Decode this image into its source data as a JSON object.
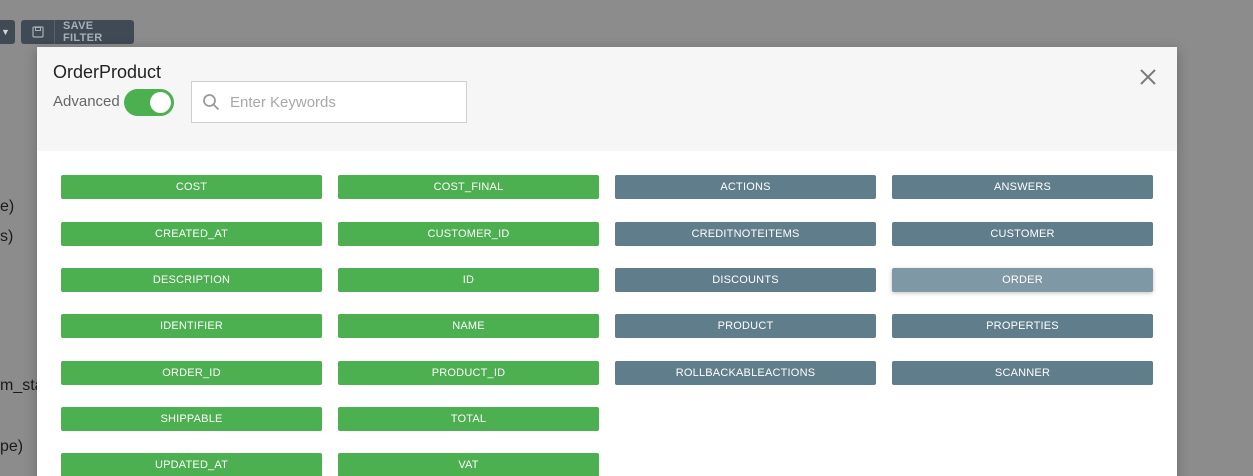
{
  "background": {
    "save_filter_label": "SAVE FILTER",
    "fragments": [
      "e)",
      "s)",
      "m_sta",
      "pe)"
    ]
  },
  "modal": {
    "title": "OrderProduct",
    "advanced_label": "Advanced",
    "advanced_on": true,
    "search": {
      "placeholder": "Enter Keywords",
      "value": ""
    },
    "columns": [
      {
        "kind": "attribute",
        "items": [
          "COST",
          "CREATED_AT",
          "DESCRIPTION",
          "IDENTIFIER",
          "ORDER_ID",
          "SHIPPABLE",
          "UPDATED_AT"
        ]
      },
      {
        "kind": "attribute",
        "items": [
          "COST_FINAL",
          "CUSTOMER_ID",
          "ID",
          "NAME",
          "PRODUCT_ID",
          "TOTAL",
          "VAT"
        ]
      },
      {
        "kind": "relation",
        "items": [
          "ACTIONS",
          "CREDITNOTEITEMS",
          "DISCOUNTS",
          "PRODUCT",
          "ROLLBACKABLEACTIONS"
        ]
      },
      {
        "kind": "relation",
        "items": [
          "ANSWERS",
          "CUSTOMER",
          "ORDER",
          "PROPERTIES",
          "SCANNER"
        ]
      }
    ],
    "hovered_item": "ORDER"
  },
  "colors": {
    "attribute": "#4caf50",
    "relation": "#607d8b",
    "relation_hover": "#7f98a5",
    "toggle_on": "#4caf50"
  }
}
